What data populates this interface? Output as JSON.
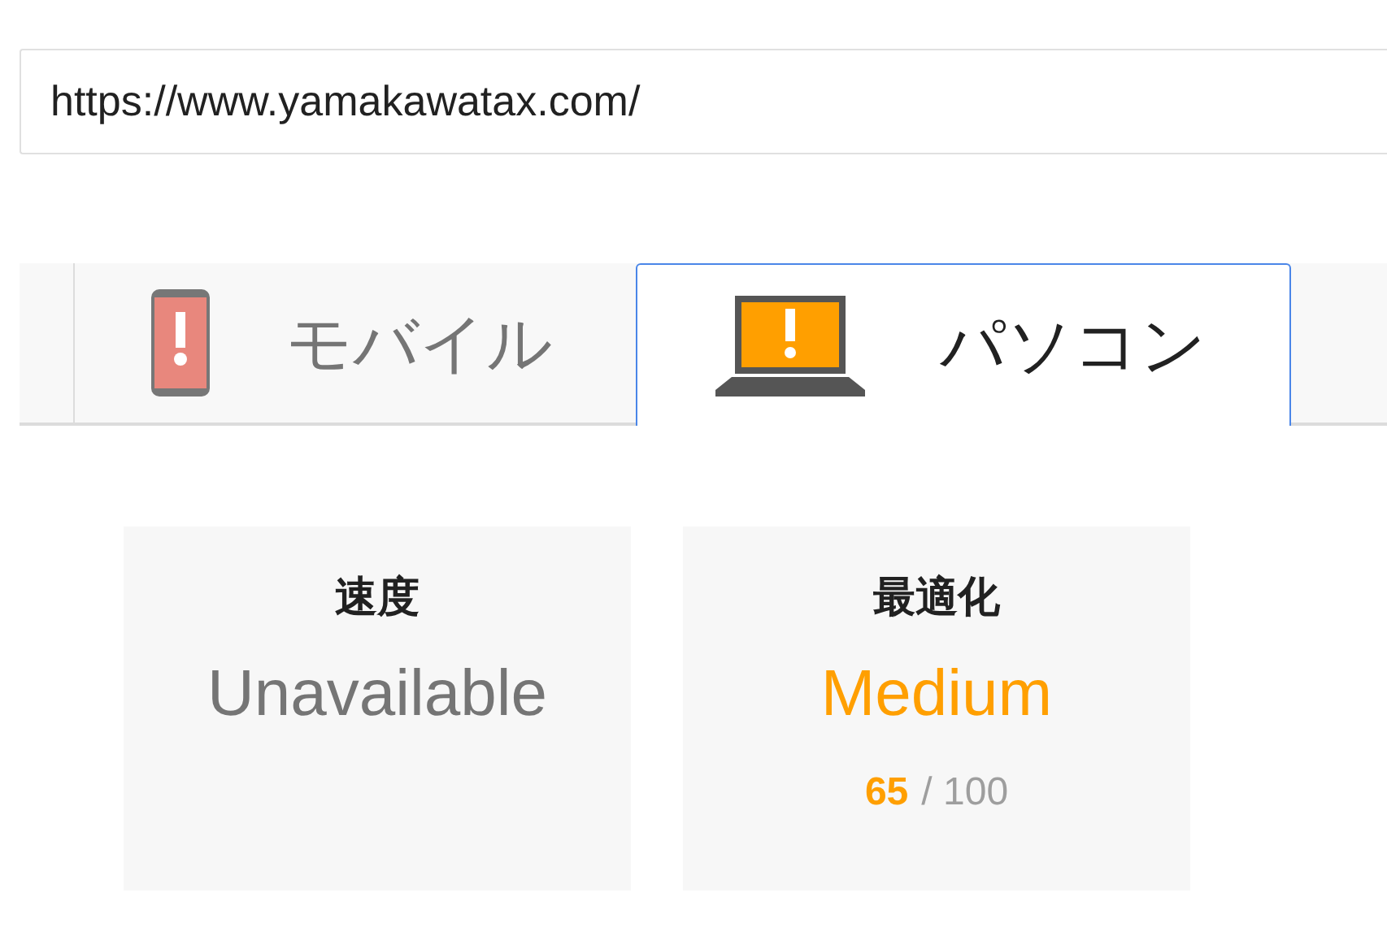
{
  "url_field": {
    "value": "https://www.yamakawatax.com/"
  },
  "tabs": [
    {
      "label": "モバイル",
      "kind": "mobile",
      "color": "#e8877d",
      "selected": false
    },
    {
      "label": "パソコン",
      "kind": "desktop",
      "color": "#ff9f00",
      "selected": true
    }
  ],
  "cards": [
    {
      "title": "速度",
      "rating": "Unavailable",
      "color": "#757575"
    },
    {
      "title": "最適化",
      "rating": "Medium",
      "color": "#ff9f00",
      "score": "65",
      "max": "/ 100"
    }
  ]
}
